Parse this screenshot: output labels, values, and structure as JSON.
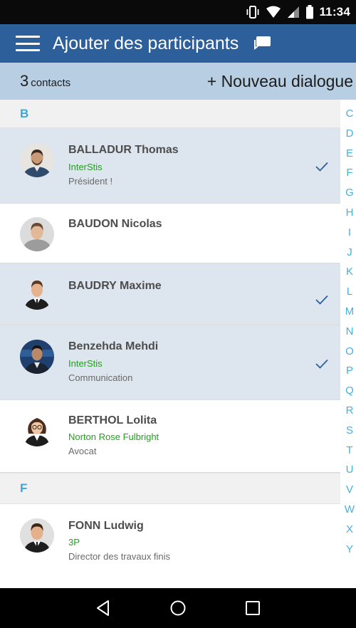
{
  "status_bar": {
    "time": "11:34"
  },
  "app_bar": {
    "title": "Ajouter des participants",
    "menu_icon": "hamburger-menu-icon",
    "chat_icon": "chat-bubble-icon"
  },
  "sub_bar": {
    "count": "3",
    "count_label": "contacts",
    "new_dialog_label": "+ Nouveau dialogue"
  },
  "sections": [
    {
      "letter": "B",
      "contacts": [
        {
          "name": "BALLADUR Thomas",
          "company": "InterStis",
          "role": "Président !",
          "selected": true
        },
        {
          "name": "BAUDON Nicolas",
          "company": "",
          "role": "",
          "selected": false
        },
        {
          "name": "BAUDRY Maxime",
          "company": "",
          "role": "",
          "selected": true
        },
        {
          "name": "Benzehda Mehdi",
          "company": "InterStis",
          "role": "Communication",
          "selected": true
        },
        {
          "name": "BERTHOL Lolita",
          "company": "Norton Rose Fulbright",
          "role": "Avocat",
          "selected": false
        }
      ]
    },
    {
      "letter": "F",
      "contacts": [
        {
          "name": "FONN Ludwig",
          "company": "3P",
          "role": "Director des travaux finis",
          "selected": false
        }
      ]
    }
  ],
  "alphabet": [
    "C",
    "D",
    "E",
    "F",
    "G",
    "H",
    "I",
    "J",
    "K",
    "L",
    "M",
    "N",
    "O",
    "P",
    "Q",
    "R",
    "S",
    "T",
    "U",
    "V",
    "W",
    "X",
    "Y"
  ],
  "colors": {
    "app_bar": "#2d5f9a",
    "sub_bar": "#b7cee3",
    "accent": "#38a8d8",
    "company": "#23a01e",
    "selected_row": "#dde5ee"
  },
  "nav_bar": {
    "icons": [
      "back-triangle-icon",
      "home-circle-icon",
      "recents-square-icon"
    ]
  }
}
